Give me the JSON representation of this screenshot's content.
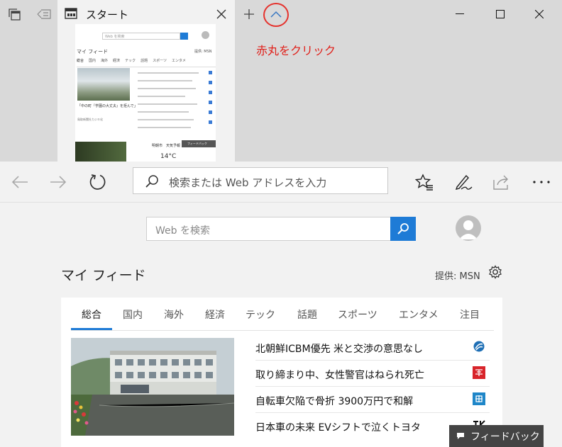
{
  "tab": {
    "title": "スタート"
  },
  "annotation": "赤丸をクリック",
  "address_bar": {
    "placeholder": "検索または Web アドレスを入力"
  },
  "page": {
    "search_placeholder": "Web を検索",
    "feed_title": "マイ フィード",
    "provider": "提供: MSN",
    "tabs": [
      "総合",
      "国内",
      "海外",
      "経済",
      "テック",
      "話題",
      "スポーツ",
      "エンタメ",
      "注目"
    ],
    "news": [
      {
        "title": "北朝鮮ICBM優先 米と交渉の意思なし",
        "logo": "jiji-logo",
        "logo_color": "#1e6fb5"
      },
      {
        "title": "取り締まり中、女性警官はねられ死亡",
        "logo": "mainichi-logo",
        "logo_color": "#d8242a"
      },
      {
        "title": "自転車欠陥で骨折 3900万円で和解",
        "logo": "mainichi-logo",
        "logo_color": "#1f86c8"
      },
      {
        "title": "日本車の未来 EVシフトで泣くトヨタ",
        "logo": "tk-logo",
        "logo_color": "#111111"
      }
    ],
    "feedback": "フィードバック"
  },
  "preview": {
    "search_placeholder": "Web を検索",
    "feed_title": "マイ フィード",
    "provider": "提供: MSN",
    "tabs": [
      "総合",
      "国内",
      "海外",
      "経済",
      "テック",
      "話題",
      "スポーツ",
      "エンタメ"
    ],
    "caption": "「中の町『学園の大丈夫』を拒んで」",
    "source": "鳥取新聞社カジキ化",
    "feedback": "フィードバック",
    "weather": "明朝市　天気予報",
    "temp": "14°C"
  }
}
